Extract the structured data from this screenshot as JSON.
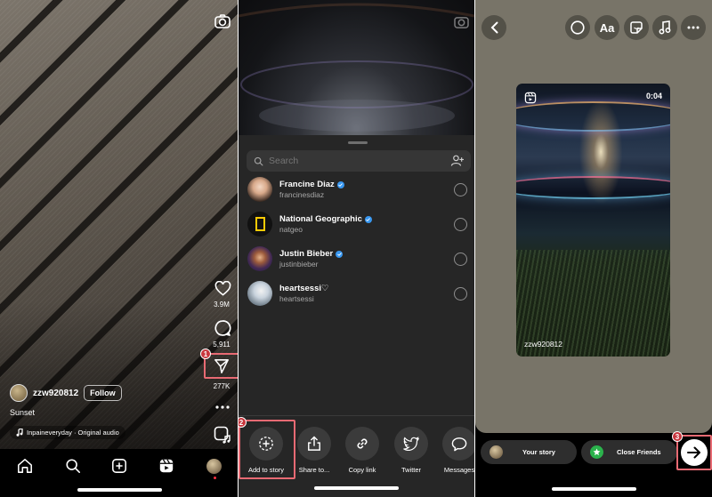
{
  "panel1": {
    "likes_count": "3.9M",
    "comments_count": "5,911",
    "shares_count": "277K",
    "username": "zzw920812",
    "follow_label": "Follow",
    "caption": "Sunset",
    "audio": "Inpaineveryday · Original audio",
    "step_badge": "1",
    "icons": [
      "camera-icon",
      "heart-icon",
      "comment-icon",
      "send-icon",
      "more-icon",
      "remix-icon",
      "home-icon",
      "search-icon",
      "create-icon",
      "reels-icon",
      "profile-avatar"
    ]
  },
  "panel2": {
    "search_placeholder": "Search",
    "contacts": [
      {
        "name": "Francine Diaz",
        "handle": "francinesdiaz",
        "verified": true
      },
      {
        "name": "National Geographic",
        "handle": "natgeo",
        "verified": true
      },
      {
        "name": "Justin Bieber",
        "handle": "justinbieber",
        "verified": true
      },
      {
        "name": "heartsessi♡",
        "handle": "heartsessi",
        "verified": false
      }
    ],
    "actions": [
      {
        "label": "Add to story",
        "icon": "add-to-story-icon"
      },
      {
        "label": "Share to...",
        "icon": "share-icon"
      },
      {
        "label": "Copy link",
        "icon": "link-icon"
      },
      {
        "label": "Twitter",
        "icon": "twitter-icon"
      },
      {
        "label": "Messages",
        "icon": "messages-icon"
      }
    ],
    "step_badge": "2"
  },
  "panel3": {
    "tools": [
      "back-icon",
      "circle-icon",
      "text-tool-icon",
      "sticker-icon",
      "music-icon",
      "more-icon"
    ],
    "text_tool_label": "Aa",
    "duration": "0:04",
    "card_username": "zzw920812",
    "your_story_label": "Your story",
    "close_friends_label": "Close Friends",
    "step_badge": "3"
  },
  "colors": {
    "highlight": "#e86a73",
    "badge": "#c8363d",
    "verified": "#3897f0",
    "close_friends_green": "#2bb24c",
    "story_bg": "#787468"
  }
}
